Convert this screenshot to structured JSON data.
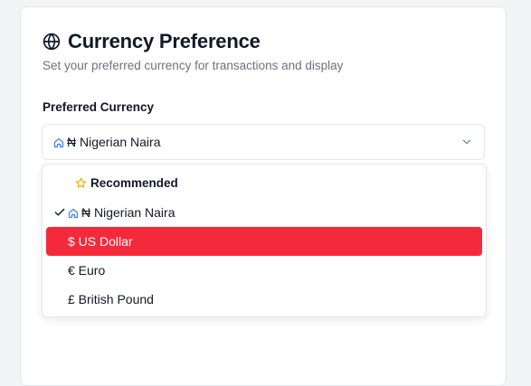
{
  "header": {
    "title": "Currency Preference",
    "subtitle": "Set your preferred currency for transactions and display"
  },
  "field": {
    "label": "Preferred Currency",
    "selected_value": "₦ Nigerian Naira"
  },
  "dropdown": {
    "group_label": "Recommended",
    "options": [
      {
        "label": "₦ Nigerian Naira",
        "selected": true,
        "highlighted": false,
        "icon": "home-icon"
      },
      {
        "label": "$ US Dollar",
        "selected": false,
        "highlighted": true
      },
      {
        "label": "€ Euro",
        "selected": false,
        "highlighted": false
      },
      {
        "label": "£ British Pound",
        "selected": false,
        "highlighted": false
      }
    ]
  },
  "colors": {
    "highlight": "#f42a3a",
    "home_icon": "#3b82f6",
    "star_icon": "#eab308"
  },
  "icons": {
    "title": "globe-icon",
    "select_prefix": "home-icon",
    "select_trailing": "chevron-down-icon",
    "group": "star-icon",
    "selected_marker": "check-icon"
  }
}
